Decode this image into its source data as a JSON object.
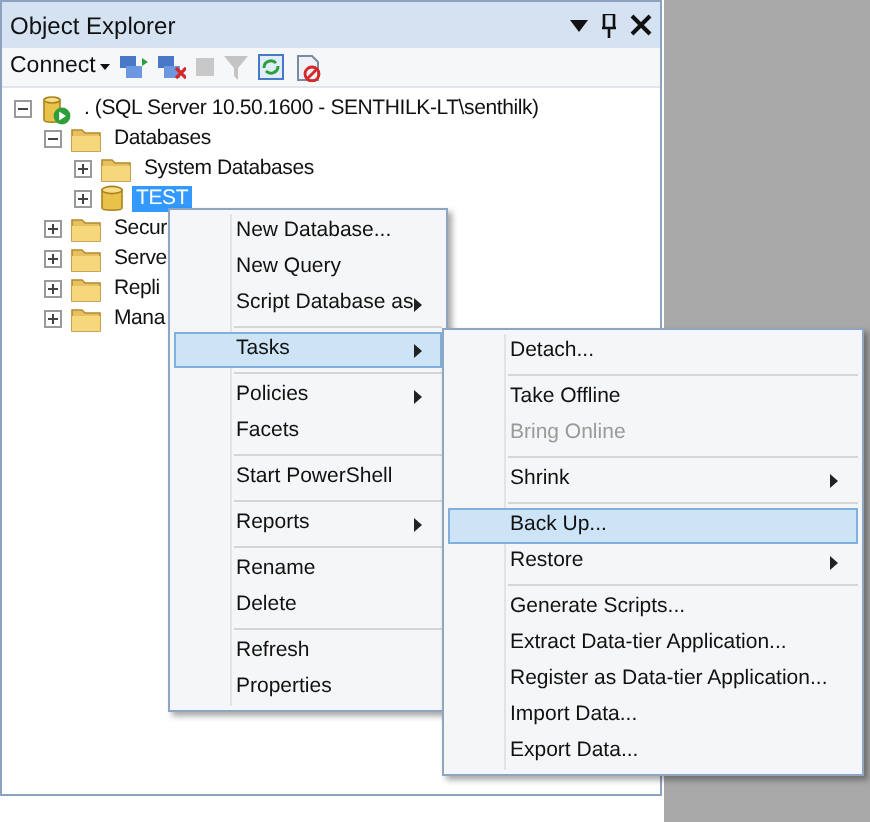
{
  "window": {
    "title": "Object Explorer"
  },
  "toolbar": {
    "connect": {
      "label": "Connect"
    }
  },
  "tree": [
    {
      "label": ". (SQL Server 10.50.1600 - SENTHILK-LT\\senthilk)",
      "kind": "server",
      "expanded": true,
      "selected": false,
      "children": [
        {
          "label": "Databases",
          "kind": "folder",
          "expanded": true,
          "selected": false,
          "children": [
            {
              "label": "System Databases",
              "kind": "folder",
              "expanded": false,
              "selected": false
            },
            {
              "label": "TEST",
              "kind": "database",
              "expanded": false,
              "selected": true
            }
          ]
        },
        {
          "label": "Secur",
          "kind": "folder",
          "expanded": false,
          "selected": false
        },
        {
          "label": "Serve",
          "kind": "folder",
          "expanded": false,
          "selected": false
        },
        {
          "label": "Repli",
          "kind": "folder",
          "expanded": false,
          "selected": false
        },
        {
          "label": "Mana",
          "kind": "folder",
          "expanded": false,
          "selected": false
        }
      ]
    }
  ],
  "context_menu": {
    "groups": [
      [
        {
          "label": "New Database...",
          "submenu": false,
          "selected": false,
          "disabled": false
        },
        {
          "label": "New Query",
          "submenu": false,
          "selected": false,
          "disabled": false
        },
        {
          "label": "Script Database as",
          "submenu": true,
          "selected": false,
          "disabled": false
        }
      ],
      [
        {
          "label": "Tasks",
          "submenu": true,
          "selected": true,
          "disabled": false
        }
      ],
      [
        {
          "label": "Policies",
          "submenu": true,
          "selected": false,
          "disabled": false
        },
        {
          "label": "Facets",
          "submenu": false,
          "selected": false,
          "disabled": false
        }
      ],
      [
        {
          "label": "Start PowerShell",
          "submenu": false,
          "selected": false,
          "disabled": false
        }
      ],
      [
        {
          "label": "Reports",
          "submenu": true,
          "selected": false,
          "disabled": false
        }
      ],
      [
        {
          "label": "Rename",
          "submenu": false,
          "selected": false,
          "disabled": false
        },
        {
          "label": "Delete",
          "submenu": false,
          "selected": false,
          "disabled": false
        }
      ],
      [
        {
          "label": "Refresh",
          "submenu": false,
          "selected": false,
          "disabled": false
        },
        {
          "label": "Properties",
          "submenu": false,
          "selected": false,
          "disabled": false
        }
      ]
    ]
  },
  "tasks_submenu": {
    "groups": [
      [
        {
          "label": "Detach...",
          "submenu": false,
          "selected": false,
          "disabled": false
        }
      ],
      [
        {
          "label": "Take Offline",
          "submenu": false,
          "selected": false,
          "disabled": false
        },
        {
          "label": "Bring Online",
          "submenu": false,
          "selected": false,
          "disabled": true
        }
      ],
      [
        {
          "label": "Shrink",
          "submenu": true,
          "selected": false,
          "disabled": false
        }
      ],
      [
        {
          "label": "Back Up...",
          "submenu": false,
          "selected": true,
          "disabled": false
        },
        {
          "label": "Restore",
          "submenu": true,
          "selected": false,
          "disabled": false
        }
      ],
      [
        {
          "label": "Generate Scripts...",
          "submenu": false,
          "selected": false,
          "disabled": false
        },
        {
          "label": "Extract Data-tier Application...",
          "submenu": false,
          "selected": false,
          "disabled": false
        },
        {
          "label": "Register as Data-tier Application...",
          "submenu": false,
          "selected": false,
          "disabled": false
        },
        {
          "label": "Import Data...",
          "submenu": false,
          "selected": false,
          "disabled": false
        },
        {
          "label": "Export Data...",
          "submenu": false,
          "selected": false,
          "disabled": false
        }
      ]
    ]
  }
}
